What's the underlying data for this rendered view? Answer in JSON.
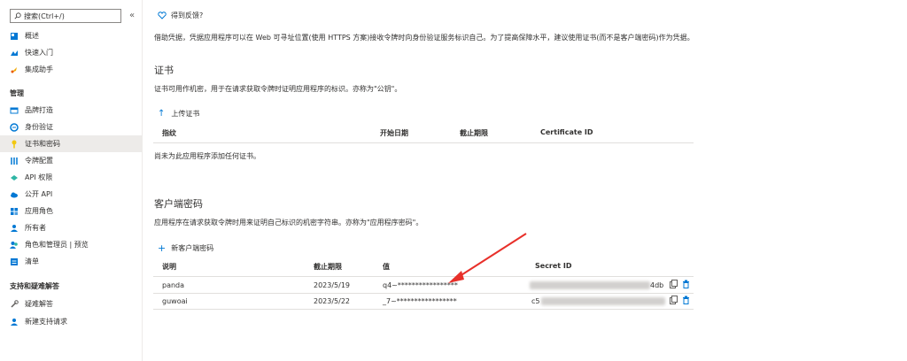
{
  "sidebar": {
    "search_placeholder": "搜索(Ctrl+/)",
    "collapse_glyph": "«",
    "items_top": [
      {
        "label": "概述",
        "icon": "overview-icon"
      },
      {
        "label": "快速入门",
        "icon": "quickstart-icon"
      },
      {
        "label": "集成助手",
        "icon": "rocket-icon"
      }
    ],
    "section_manage": "管理",
    "items_manage": [
      {
        "label": "品牌打造",
        "icon": "branding-icon"
      },
      {
        "label": "身份验证",
        "icon": "auth-icon"
      },
      {
        "label": "证书和密码",
        "icon": "key-icon"
      },
      {
        "label": "令牌配置",
        "icon": "token-icon"
      },
      {
        "label": "API 权限",
        "icon": "api-permissions-icon"
      },
      {
        "label": "公开 API",
        "icon": "cloud-icon"
      },
      {
        "label": "应用角色",
        "icon": "app-roles-icon"
      },
      {
        "label": "所有者",
        "icon": "owner-icon"
      },
      {
        "label": "角色和管理员 | 预览",
        "icon": "roles-admins-icon"
      },
      {
        "label": "清单",
        "icon": "manifest-icon"
      }
    ],
    "section_support": "支持和疑难解答",
    "items_support": [
      {
        "label": "疑难解答",
        "icon": "wrench-icon"
      },
      {
        "label": "新建支持请求",
        "icon": "support-request-icon"
      }
    ]
  },
  "main": {
    "feedback": "得到反馈?",
    "intro": "借助凭据，凭据应用程序可以在 Web 可寻址位置(使用 HTTPS 方案)接收令牌时向身份验证服务标识自己。为了提高保障水平，建议使用证书(而不是客户端密码)作为凭据。",
    "certificates": {
      "title": "证书",
      "desc": "证书可用作机密，用于在请求获取令牌时证明应用程序的标识。亦称为\"公钥\"。",
      "upload_label": "上传证书",
      "columns": [
        "指纹",
        "开始日期",
        "截止期限",
        "Certificate ID"
      ],
      "empty": "尚未为此应用程序添加任何证书。"
    },
    "secrets": {
      "title": "客户端密码",
      "desc": "应用程序在请求获取令牌时用来证明自己标识的机密字符串。亦称为\"应用程序密码\"。",
      "new_label": "新客户端密码",
      "columns": [
        "说明",
        "截止期限",
        "值",
        "Secret ID"
      ],
      "rows": [
        {
          "description": "panda",
          "expires": "2023/5/19",
          "value": "q4~*****************",
          "secret_id_suffix": "4db"
        },
        {
          "description": "guwoai",
          "expires": "2023/5/22",
          "value": "_7~*****************",
          "secret_id_prefix": "c5"
        }
      ]
    }
  },
  "colors": {
    "accent": "#0078d4",
    "arrow": "#e8302a",
    "delete": "#0078d4"
  }
}
